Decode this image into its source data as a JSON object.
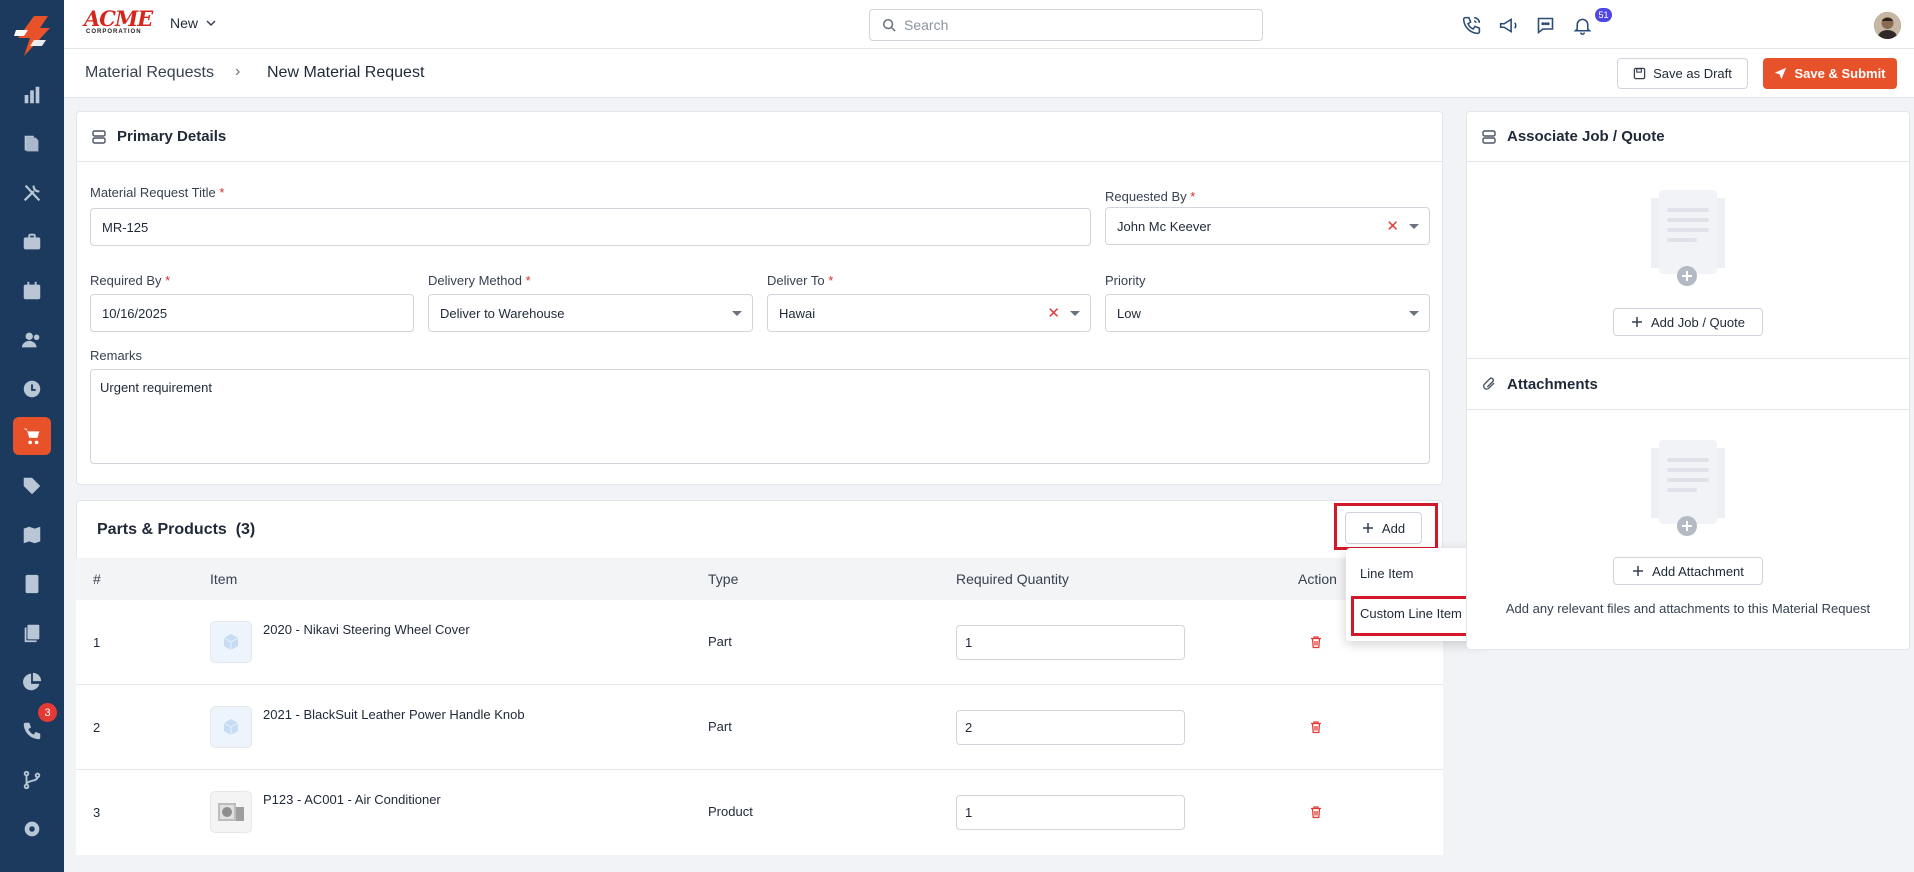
{
  "topbar": {
    "brand_main": "ACME",
    "brand_sub": "CORPORATION",
    "new_label": "New",
    "search_placeholder": "Search",
    "notification_count": "51"
  },
  "sidebar": {
    "items": [
      "logo",
      "dashboard",
      "documents",
      "tools",
      "jobs",
      "calendar",
      "customers",
      "time",
      "purchasing",
      "tags",
      "map",
      "invoices",
      "files",
      "reports",
      "calls",
      "workflow",
      "settings"
    ],
    "active": "purchasing",
    "calls_badge": "3"
  },
  "header": {
    "breadcrumb_parent": "Material Requests",
    "breadcrumb_current": "New Material Request",
    "draft_label": "Save as Draft",
    "submit_label": "Save & Submit"
  },
  "primary": {
    "title": "Primary Details",
    "title_label": "Material Request Title",
    "title_value": "MR-125",
    "requested_by_label": "Requested By",
    "requested_by_value": "John Mc Keever",
    "required_by_label": "Required By",
    "required_by_value": "10/16/2025",
    "delivery_method_label": "Delivery Method",
    "delivery_method_value": "Deliver to Warehouse",
    "deliver_to_label": "Deliver To",
    "deliver_to_value": "Hawai",
    "priority_label": "Priority",
    "priority_value": "Low",
    "remarks_label": "Remarks",
    "remarks_value": "Urgent requirement",
    "required_mark": "*"
  },
  "parts": {
    "title": "Parts & Products",
    "count": "(3)",
    "add_label": "Add",
    "columns": [
      "#",
      "Item",
      "Type",
      "Required Quantity",
      "Action"
    ],
    "rows": [
      {
        "num": "1",
        "item": "2020 - Nikavi Steering Wheel Cover",
        "type": "Part",
        "qty": "1"
      },
      {
        "num": "2",
        "item": "2021 - BlackSuit Leather Power Handle Knob",
        "type": "Part",
        "qty": "2"
      },
      {
        "num": "3",
        "item": "P123 - AC001 - Air Conditioner",
        "type": "Product",
        "qty": "1"
      }
    ],
    "menu": [
      "Line Item",
      "Custom Line Item"
    ]
  },
  "associate": {
    "title": "Associate Job / Quote",
    "button": "Add Job / Quote"
  },
  "attachments": {
    "title": "Attachments",
    "button": "Add Attachment",
    "hint": "Add any relevant files and attachments to this Material Request"
  },
  "colors": {
    "sidebar": "#1c3a5e",
    "accent": "#e8522b",
    "highlight": "#d3182a"
  }
}
